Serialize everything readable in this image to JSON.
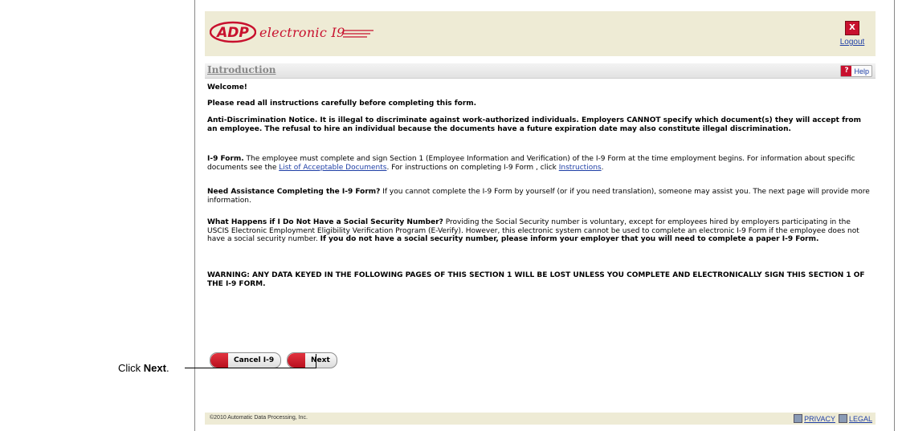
{
  "header": {
    "brand_logo": "ADP",
    "brand_text": "electronic I9",
    "logout_icon": "X",
    "logout_label": "Logout"
  },
  "section": {
    "title": "Introduction",
    "help_icon": "?",
    "help_label": "Help"
  },
  "content": {
    "welcome": "Welcome!",
    "read_instructions": "Please read all instructions carefully before completing this form.",
    "anti_discrimination": "Anti-Discrimination Notice. It is illegal to discriminate against work-authorized individuals. Employers CANNOT specify which document(s) they will accept from an employee. The refusal to hire an individual because the documents have a future expiration date may also constitute illegal discrimination.",
    "i9_title": "I-9 Form.",
    "i9_text_1": " The employee must complete and sign Section 1 (Employee Information and Verification) of the I-9 Form at the time employment begins. For information about specific documents see the ",
    "i9_link_documents": "List of Acceptable Documents",
    "i9_text_2": ". For instructions on completing I-9 Form , click ",
    "i9_link_instructions": "Instructions",
    "i9_text_3": ".",
    "assist_title": "Need Assistance Completing the I-9 Form?",
    "assist_text": " If you cannot complete the I-9 Form by yourself (or if you need translation), someone may assist you. The next page will provide more information.",
    "ssn_title": "What Happens if I Do Not Have a Social Security Number?",
    "ssn_text": " Providing the Social Security number is voluntary, except for employees hired by employers participating in the USCIS Electronic Employment Eligibility Verification Program (E-Verify). However, this electronic system cannot be used to complete an electronic I-9 Form if the employee does not have a social security number. ",
    "ssn_bold": "If you do not have a social security number, please inform your employer that you will need to complete a paper I-9 Form.",
    "warning": "WARNING: ANY DATA KEYED IN THE FOLLOWING PAGES OF THIS SECTION 1 WILL BE LOST UNLESS YOU COMPLETE AND ELECTRONICALLY SIGN THIS SECTION 1 OF THE I-9 FORM."
  },
  "buttons": {
    "cancel": "Cancel I-9",
    "next": "Next"
  },
  "footer": {
    "copyright": "©2010 Automatic Data Processing, Inc.",
    "privacy": "PRIVACY",
    "legal": "LEGAL"
  },
  "callout": {
    "prefix": "Click ",
    "emphasis": "Next",
    "suffix": "."
  },
  "colors": {
    "brand_red": "#c8102e",
    "header_bg": "#eeebd5",
    "link_blue": "#1f3fa6"
  }
}
